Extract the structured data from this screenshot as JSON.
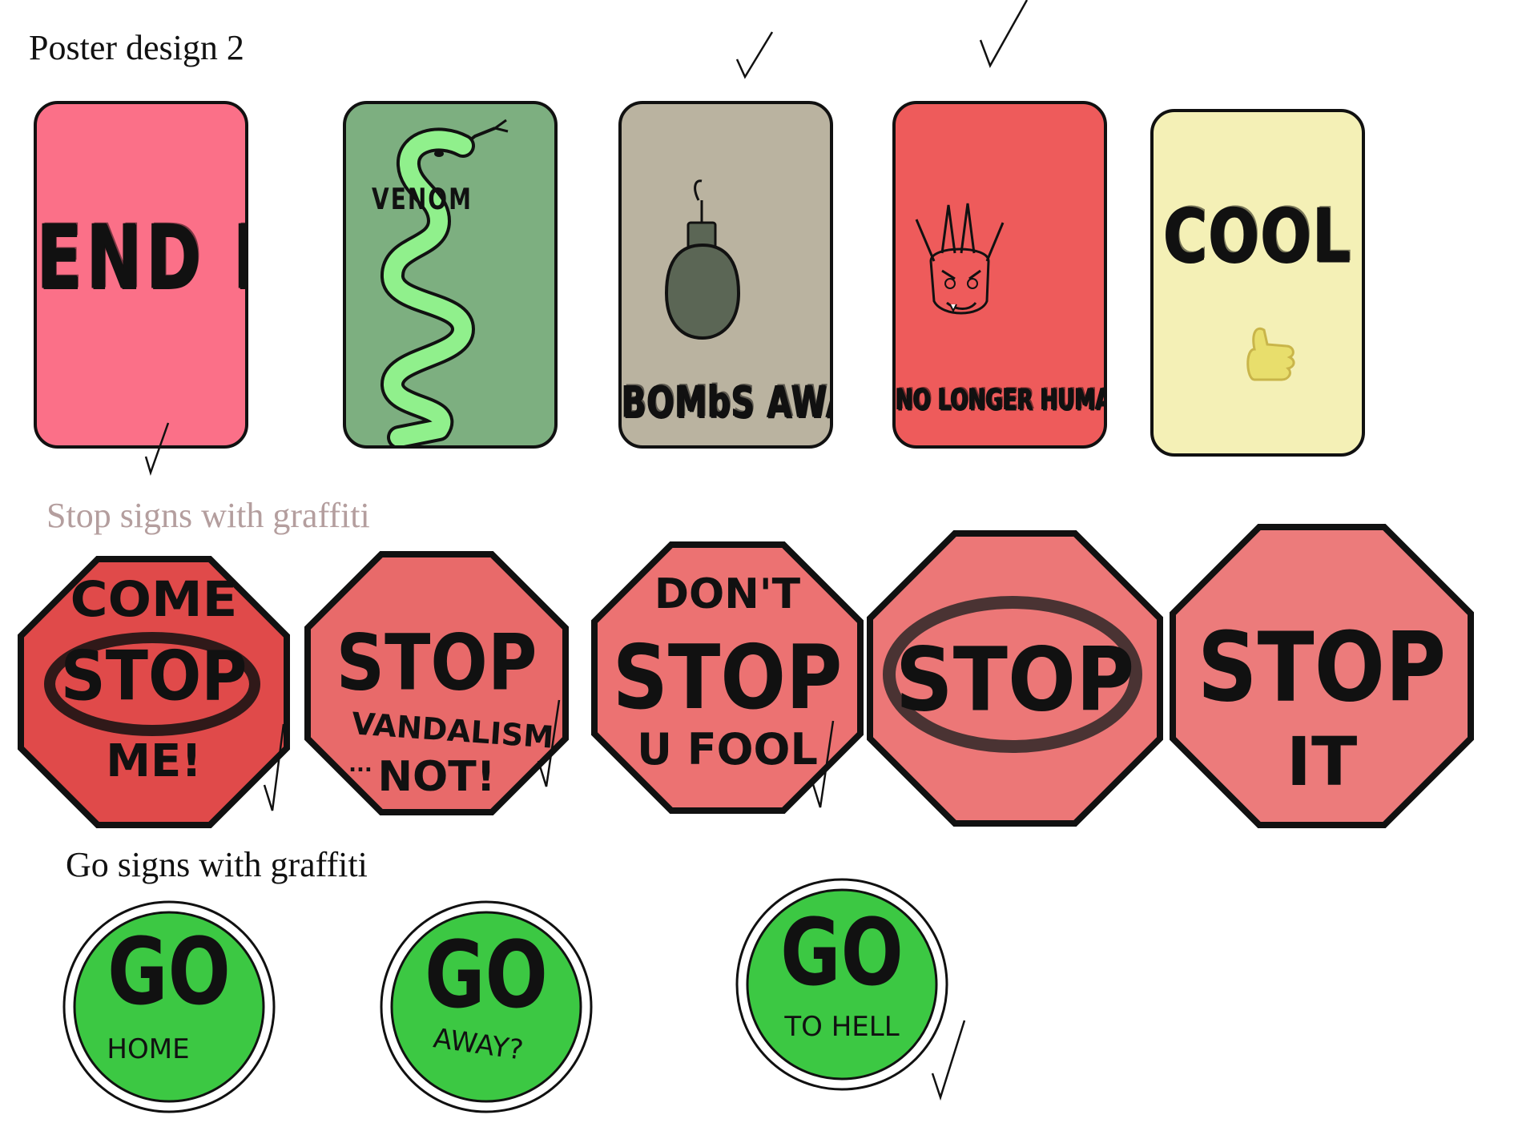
{
  "sections": {
    "posters_title": "Poster design 2",
    "stop_title": "Stop signs with graffiti",
    "go_title": "Go signs with graffiti"
  },
  "posters": [
    {
      "text": "END IT",
      "bg": "#fb7088"
    },
    {
      "text": "VENOM",
      "bg": "#7daf80"
    },
    {
      "text": "BOMbS AWAY",
      "bg": "#bab3a0"
    },
    {
      "text": "NO LONGER HUMAN",
      "bg": "#ee5b5b"
    },
    {
      "text": "COOL",
      "bg": "#f4f0b6"
    }
  ],
  "stop_signs": [
    {
      "top": "COME",
      "main": "STOP",
      "bottom": "ME!",
      "bg": "#e04a4a"
    },
    {
      "main": "STOP",
      "bottom": "VANDALISM",
      "bottom2": "NOT!",
      "prefix": "...",
      "bg": "#e86a6a"
    },
    {
      "top": "DON'T",
      "main": "STOP",
      "bottom": "U FOOL",
      "bg": "#ec7272"
    },
    {
      "main": "STOP",
      "bg": "#ec7777"
    },
    {
      "main": "STOP",
      "bottom": "IT",
      "bg": "#ec7b7b"
    }
  ],
  "go_signs": [
    {
      "main": "GO",
      "sub": "HOME",
      "bg": "#3cc843"
    },
    {
      "main": "GO",
      "sub": "AWAY?",
      "bg": "#3cc843"
    },
    {
      "main": "GO",
      "sub": "TO HELL",
      "bg": "#3cc843"
    }
  ],
  "colors": {
    "outline": "#111111",
    "snake_fill": "#90f08c",
    "bomb_fill": "#5b6655",
    "thumb_fill": "#e8de6c",
    "stop_title_color": "#b49e9e"
  },
  "icons": [
    "snake-icon",
    "bomb-icon",
    "demon-head-icon",
    "thumbs-up-icon",
    "checkmark-icon"
  ]
}
